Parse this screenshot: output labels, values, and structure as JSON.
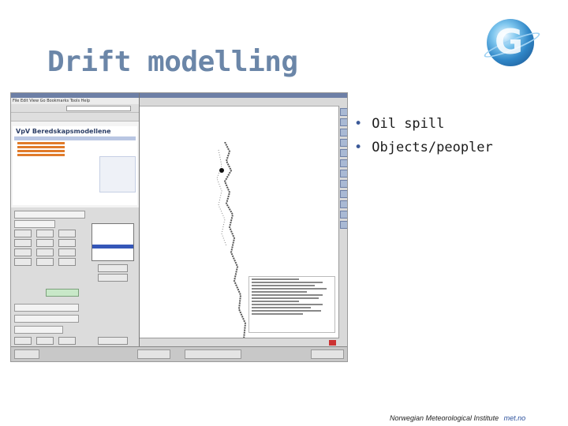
{
  "slide": {
    "title": "Drift modelling",
    "bullets": [
      "Oil spill",
      "Objects/peopler"
    ],
    "footer_org": "Norwegian Meteorological Institute",
    "footer_url": "met.no"
  },
  "screenshot": {
    "browser_heading": "VpV Beredskapsmodellene",
    "browser_menu": "File  Edit  View  Go  Bookmarks  Tools  Help"
  },
  "icons": {
    "logo": "globe-logo-icon"
  }
}
